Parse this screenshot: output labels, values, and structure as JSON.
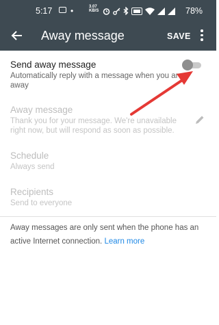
{
  "status_bar": {
    "time": "5:17",
    "dot": "•",
    "speed_top": "3.07",
    "speed_bottom": "KB/S",
    "battery": "78%",
    "icons": [
      "image-icon",
      "alarm-icon",
      "key-icon",
      "bluetooth-icon",
      "volte-icon",
      "wifi-icon",
      "signal-icon",
      "signal-icon"
    ]
  },
  "app_bar": {
    "title": "Away message",
    "save_label": "SAVE"
  },
  "settings": {
    "send_away": {
      "title": "Send away message",
      "subtitle": "Automatically reply with a message when you are away",
      "enabled": false
    },
    "away_message": {
      "title": "Away message",
      "text": "Thank you for your message. We're unavailable right now, but will respond as soon as possible."
    },
    "schedule": {
      "title": "Schedule",
      "value": "Always send"
    },
    "recipients": {
      "title": "Recipients",
      "value": "Send to everyone"
    }
  },
  "footer": {
    "note": "Away messages are only sent when the phone has an active Internet connection.",
    "link": "Learn more"
  },
  "colors": {
    "appbar": "#3e4a52",
    "annotation_arrow": "#e53935",
    "link": "#1e88e5"
  }
}
